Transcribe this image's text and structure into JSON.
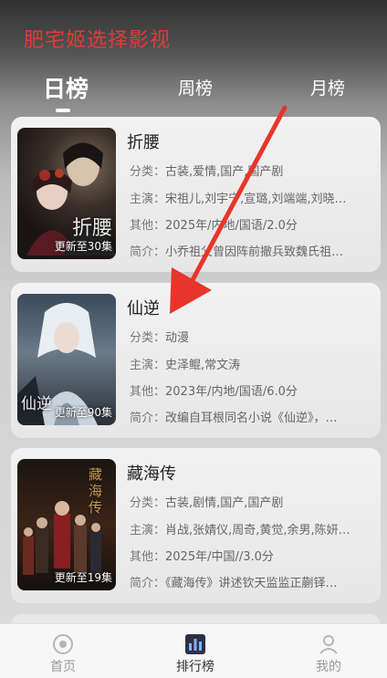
{
  "header": {
    "title": "肥宅姬选择影视"
  },
  "tabs": [
    {
      "label": "日榜",
      "active": true
    },
    {
      "label": "周榜",
      "active": false
    },
    {
      "label": "月榜",
      "active": false
    }
  ],
  "labels": {
    "genre": "分类：",
    "cast": "主演：",
    "other": "其他：",
    "intro": "简介："
  },
  "items": [
    {
      "title": "折腰",
      "badge": "更新至30集",
      "poster_text": "折腰",
      "genre": "古装,爱情,国产,国产剧",
      "cast": "宋祖儿,刘宇宁,宣璐,刘端端,刘晓…",
      "other": "2025年/内地/国语/2.0分",
      "intro": "小乔祖父曾因阵前撤兵致魏氏祖…"
    },
    {
      "title": "仙逆",
      "badge": "更新至90集",
      "poster_text": "仙逆",
      "genre": "动漫",
      "cast": "史泽鲲,常文涛",
      "other": "2023年/内地/国语/6.0分",
      "intro": "改编自耳根同名小说《仙逆》，…"
    },
    {
      "title": "藏海传",
      "badge": "更新至19集",
      "poster_text": "藏海传",
      "genre": "古装,剧情,国产,国产剧",
      "cast": "肖战,张婧仪,周奇,黄觉,余男,陈妍…",
      "other": "2025年/中国//3.0分",
      "intro": "《藏海传》讲述钦天监监正蒯铎…"
    }
  ],
  "bottom_nav": [
    {
      "label": "首页",
      "icon": "home-icon",
      "active": false
    },
    {
      "label": "排行榜",
      "icon": "ranking-icon",
      "active": true
    },
    {
      "label": "我的",
      "icon": "profile-icon",
      "active": false
    }
  ],
  "colors": {
    "title_red": "#e03a3a",
    "arrow_red": "#e8352b",
    "active_tab": "#ffffff"
  }
}
